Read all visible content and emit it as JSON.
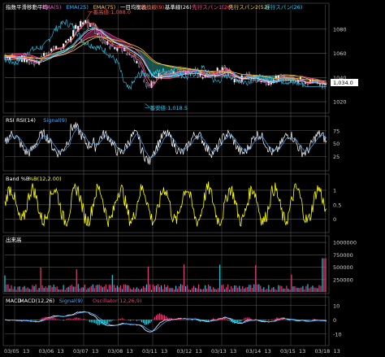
{
  "chart_data": {
    "type": "line",
    "colors": {
      "background": "#000000",
      "grid": "#5a5a5a",
      "ema5": "#ff4fd8",
      "ema25": "#37b4ff",
      "ema75": "#ffcc33",
      "conversion": "#ff6a4a",
      "base": "#ffffff",
      "span_a": "#ff4f9b",
      "span_b": "#ffd24a",
      "lagging": "#2ad4ff",
      "candle_up": "#ffffff",
      "candle_down": "#d8d8d8",
      "rsi": "#ffffff",
      "signal": "#4aa8ff",
      "pctb": "#ffff00",
      "volume": "#e0407a",
      "volume_alt": "#2ac8d8",
      "macd": "#ffffff",
      "macd_signal": "#4aa8ff",
      "osc_pos": "#e0407a",
      "osc_neg": "#29d0e0",
      "price_tag": "#ffffff",
      "high_label": "#ff4f4f",
      "low_label": "#2ad4ff"
    },
    "price_panel": {
      "title": "指数平滑移動平均",
      "legend": [
        {
          "text": "EMA(5)",
          "color": "#ff4fd8"
        },
        {
          "text": "EMA(25)",
          "color": "#37b4ff"
        },
        {
          "text": "EMA(75)",
          "color": "#ffcc33"
        },
        {
          "text": "一目均衡表",
          "color": "#ffffff"
        },
        {
          "text": "転換線(9)",
          "color": "#ff6a4a"
        },
        {
          "text": "基準線(26)",
          "color": "#ffffff"
        },
        {
          "text": "先行スパン1(26)",
          "color": "#ff4f9b"
        },
        {
          "text": "先行スパン2(52)",
          "color": "#ffd24a"
        },
        {
          "text": "遅行スパン(26)",
          "color": "#2ad4ff"
        }
      ],
      "yticks": [
        1020,
        1040,
        1060,
        1080
      ],
      "ylim": [
        1012,
        1100
      ],
      "last_price": "1,034.0",
      "high_annotation": "一番高値:1,088.0",
      "low_annotation": "一番安値:1,018.5",
      "high_value": 1088.0,
      "low_value": 1018.5
    },
    "rsi_panel": {
      "title": "RSI",
      "legend": [
        {
          "text": "RSI(14)",
          "color": "#ffffff"
        },
        {
          "text": "Signal(9)",
          "color": "#4aa8ff"
        }
      ],
      "yticks": [
        25,
        50,
        75
      ],
      "ylim": [
        0,
        100
      ]
    },
    "band_panel": {
      "title": "Band %B",
      "legend": [
        {
          "text": "%B(12,2.00)",
          "color": "#ffff00"
        }
      ],
      "yticks": [
        "0",
        "0.5",
        "1"
      ],
      "ylim": [
        -0.4,
        1.5
      ]
    },
    "volume_panel": {
      "title": "出来高",
      "yticks": [
        "250000",
        "500000",
        "750000",
        "1000000"
      ],
      "ylim": [
        0,
        1100000
      ]
    },
    "macd_panel": {
      "title": "MACD",
      "legend": [
        {
          "text": "MACD(12,26)",
          "color": "#ffffff"
        },
        {
          "text": "Signal(9)",
          "color": "#4aa8ff"
        },
        {
          "text": "Oscillator(12,26,9)",
          "color": "#e0407a"
        }
      ],
      "yticks": [
        "-10",
        "0",
        "10"
      ],
      "ylim": [
        -17,
        15
      ]
    },
    "x_axis": {
      "ticks": [
        {
          "label": "03/05",
          "sub": "13"
        },
        {
          "label": "03/06",
          "sub": "13"
        },
        {
          "label": "03/07",
          "sub": "13"
        },
        {
          "label": "03/08",
          "sub": "13"
        },
        {
          "label": "03/11",
          "sub": "13"
        },
        {
          "label": "03/12",
          "sub": "13"
        },
        {
          "label": "03/13",
          "sub": "13"
        },
        {
          "label": "03/14",
          "sub": "13"
        },
        {
          "label": "03/15",
          "sub": "13"
        },
        {
          "label": "03/18",
          "sub": "13"
        }
      ]
    }
  }
}
